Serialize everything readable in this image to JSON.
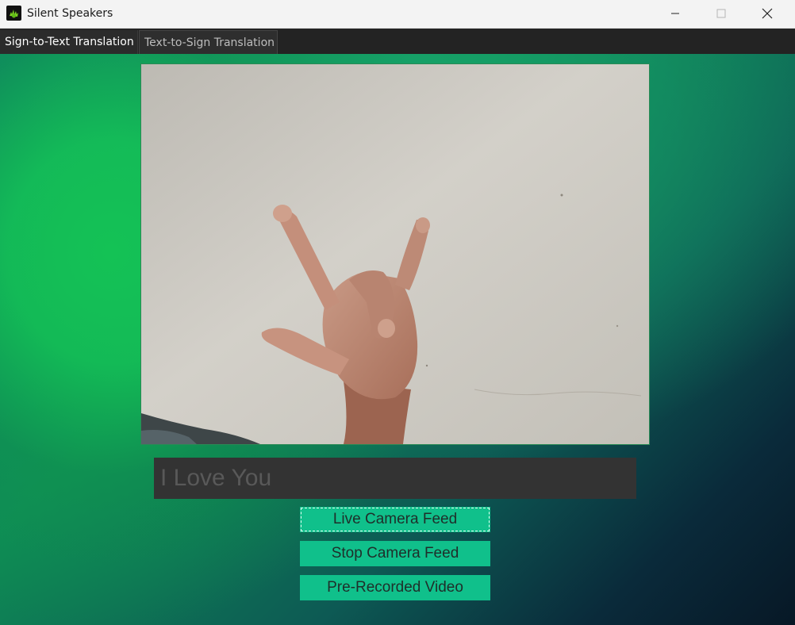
{
  "window": {
    "title": "Silent Speakers",
    "icon": "app-logo-icon"
  },
  "title_bar_controls": {
    "minimize_icon": "minimize-icon",
    "maximize_icon": "maximize-icon",
    "close_icon": "close-icon"
  },
  "tabs": [
    {
      "label": "Sign-to-Text Translation",
      "active": true
    },
    {
      "label": "Text-to-Sign Translation",
      "active": false
    }
  ],
  "camera": {
    "content": "camera-preview-image"
  },
  "prediction": {
    "text": "I Love You"
  },
  "buttons": {
    "live": "Live Camera Feed",
    "stop": "Stop Camera Feed",
    "prerecorded": "Pre-Recorded Video"
  },
  "colors": {
    "accent": "#10c08b",
    "gradient_green": "#14c255",
    "gradient_dark": "#071826",
    "field_bg": "#333333"
  }
}
